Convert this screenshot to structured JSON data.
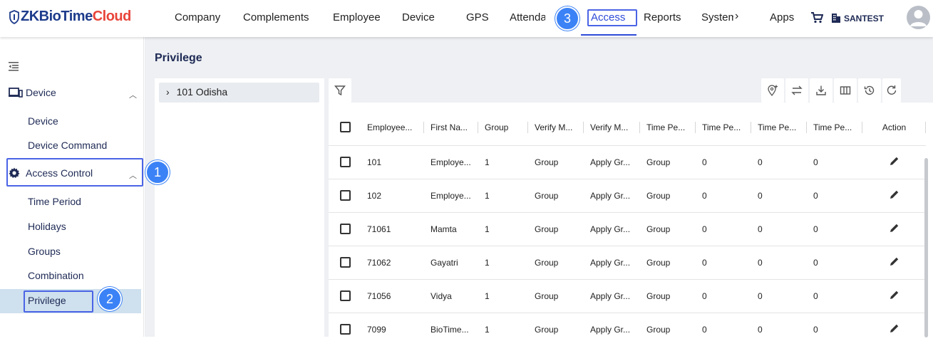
{
  "app": {
    "logo_main": "ZKBioTime",
    "logo_accent": "Cloud",
    "company": "SANTEST"
  },
  "nav": {
    "company": "Company",
    "complements": "Complements",
    "employee": "Employee",
    "device": "Device",
    "gps": "GPS",
    "attendance": "Attenda",
    "access": "Access",
    "reports": "Reports",
    "system": "System",
    "more": "›",
    "apps": "Apps"
  },
  "callouts": {
    "one": "1",
    "two": "2",
    "three": "3"
  },
  "sidebar": {
    "device_group": "Device",
    "device_items": [
      "Device",
      "Device Command"
    ],
    "access_group": "Access Control",
    "access_items": [
      "Time Period",
      "Holidays",
      "Groups",
      "Combination",
      "Privilege"
    ]
  },
  "page": {
    "title": "Privilege",
    "tree_node": "101 Odisha",
    "tree_chevron": "›"
  },
  "table": {
    "headers": [
      "Employee...",
      "First Na...",
      "Group",
      "Verify M...",
      "Verify M...",
      "Time Pe...",
      "Time Pe...",
      "Time Pe...",
      "Time Pe...",
      "Action"
    ],
    "rows": [
      [
        "101",
        "Employe...",
        "1",
        "Group",
        "Apply Gr...",
        "Group",
        "0",
        "0",
        "0"
      ],
      [
        "102",
        "Employe...",
        "1",
        "Group",
        "Apply Gr...",
        "Group",
        "0",
        "0",
        "0"
      ],
      [
        "71061",
        "Mamta",
        "1",
        "Group",
        "Apply Gr...",
        "Group",
        "0",
        "0",
        "0"
      ],
      [
        "71062",
        "Gayatri",
        "1",
        "Group",
        "Apply Gr...",
        "Group",
        "0",
        "0",
        "0"
      ],
      [
        "71056",
        "Vidya",
        "1",
        "Group",
        "Apply Gr...",
        "Group",
        "0",
        "0",
        "0"
      ],
      [
        "7099",
        "BioTime...",
        "1",
        "Group",
        "Apply Gr...",
        "Group",
        "0",
        "0",
        "0"
      ]
    ]
  },
  "colors": {
    "accent": "#2e4bd8",
    "brand_navy": "#1e3c8c",
    "brand_red": "#e8443a",
    "badge": "#3b82f6",
    "selected": "#cfe0ee"
  },
  "icons": [
    "shield-logo-icon",
    "cart-icon",
    "building-icon",
    "user-avatar-icon",
    "collapse-menu-icon",
    "device-icon",
    "gear-icon",
    "filter-icon",
    "location-add-icon",
    "transfer-icon",
    "download-icon",
    "columns-icon",
    "history-icon",
    "refresh-icon",
    "edit-pencil-icon"
  ]
}
